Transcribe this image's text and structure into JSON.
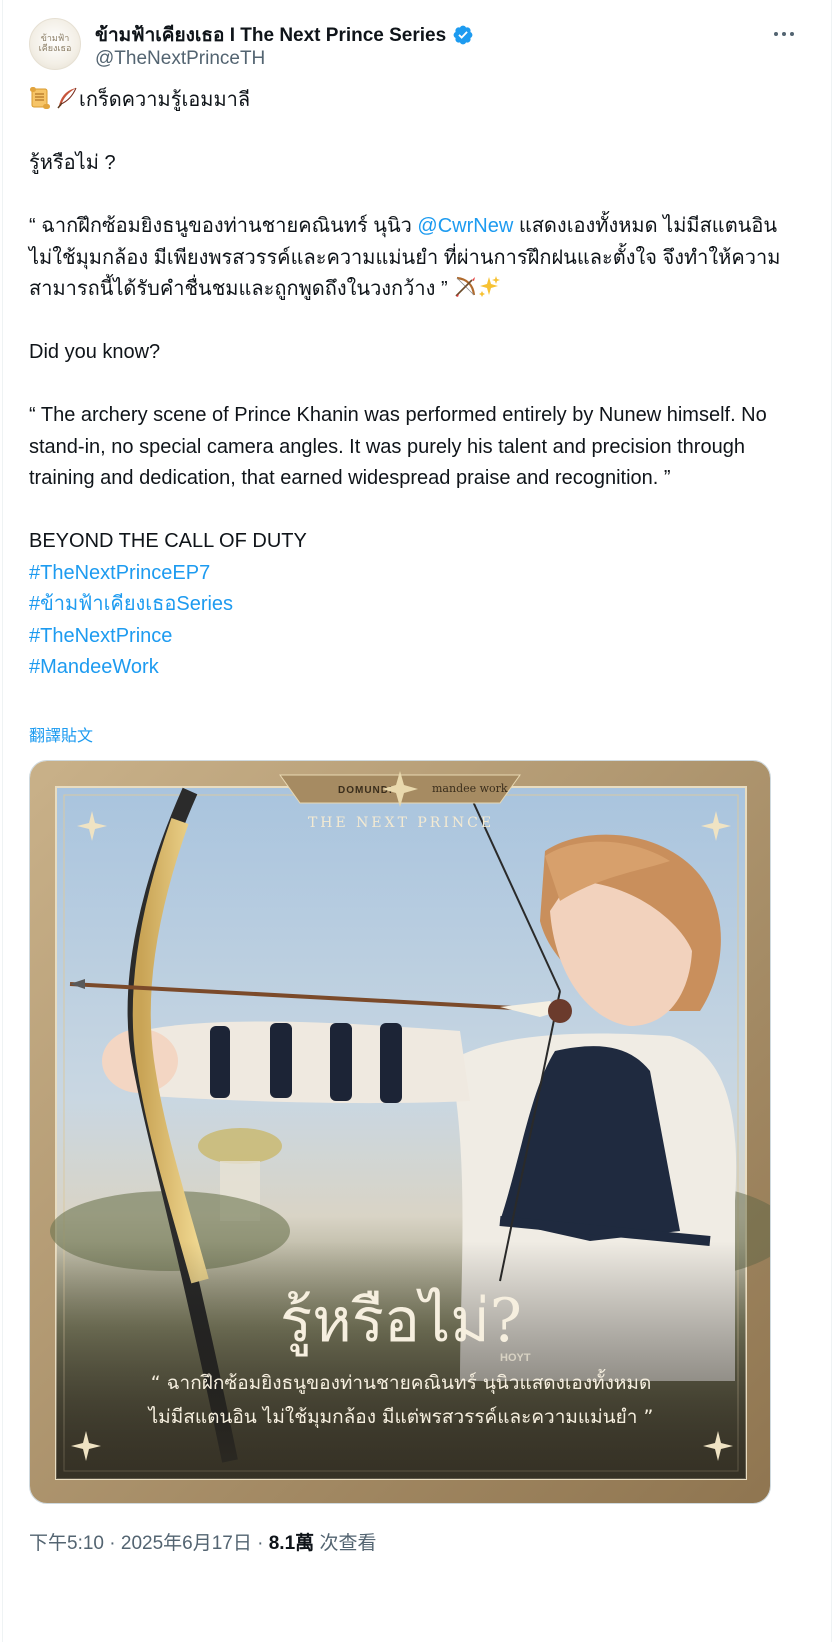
{
  "author": {
    "display_name": "ข้ามฟ้าเคียงเธอ I The Next Prince Series",
    "handle": "@TheNextPrinceTH",
    "avatar_text": "ข้ามฟ้า เคียงเธอ",
    "verified_icon": "verified-badge-icon"
  },
  "tweet": {
    "line1": "เกร็ดความรู้เอมมาลี",
    "line2": "รู้หรือไม่ ?",
    "thai_quote_a": "“ ฉากฝึกซ้อมยิงธนูของท่านชายคณินทร์ นุนิว ",
    "mention": "@CwrNew",
    "thai_quote_b": " แสดงเองทั้งหมด ไม่มีสแตนอิน ไม่ใช้มุมกล้อง มีเพียงพรสวรรค์และความแม่นยำ ที่ผ่านการฝึกฝนและตั้งใจ จึงทำให้ความสามารถนี้ได้รับคำชื่นชมและถูกพูดถึงในวงกว้าง ”",
    "did_you_know": "Did you know?",
    "english_quote": "“ The archery scene of Prince Khanin was performed entirely by Nunew himself. No stand-in, no special camera angles. It was purely his talent and precision through training and dedication, that earned widespread praise and recognition. ”",
    "tagline": "BEYOND THE CALL OF DUTY",
    "hashtags": [
      "#TheNextPrinceEP7",
      "#ข้ามฟ้าเคียงเธอSeries",
      "#TheNextPrince",
      "#MandeeWork"
    ],
    "translate_label": "翻譯貼文"
  },
  "media": {
    "logo_left": "DOMUNDI",
    "logo_right": "mandee work",
    "series_title": "THE NEXT PRINCE",
    "headline": "รู้หรือไม่?",
    "caption_line1": "“ ฉากฝึกซ้อมยิงธนูของท่านชายคณินทร์ นุนิวแสดงเองทั้งหมด",
    "caption_line2": "ไม่มีสแตนอิน ไม่ใช้มุมกล้อง มีแต่พรสวรรค์และความแม่นยำ ”",
    "bow_text": "HOYT"
  },
  "meta": {
    "time": "下午5:10",
    "date": "2025年6月17日",
    "views_count": "8.1萬",
    "views_label": "次查看",
    "sep": "·"
  },
  "colors": {
    "link": "#1d9bf0",
    "secondary_text": "#536471",
    "frame_gold": "#b79a6c"
  }
}
